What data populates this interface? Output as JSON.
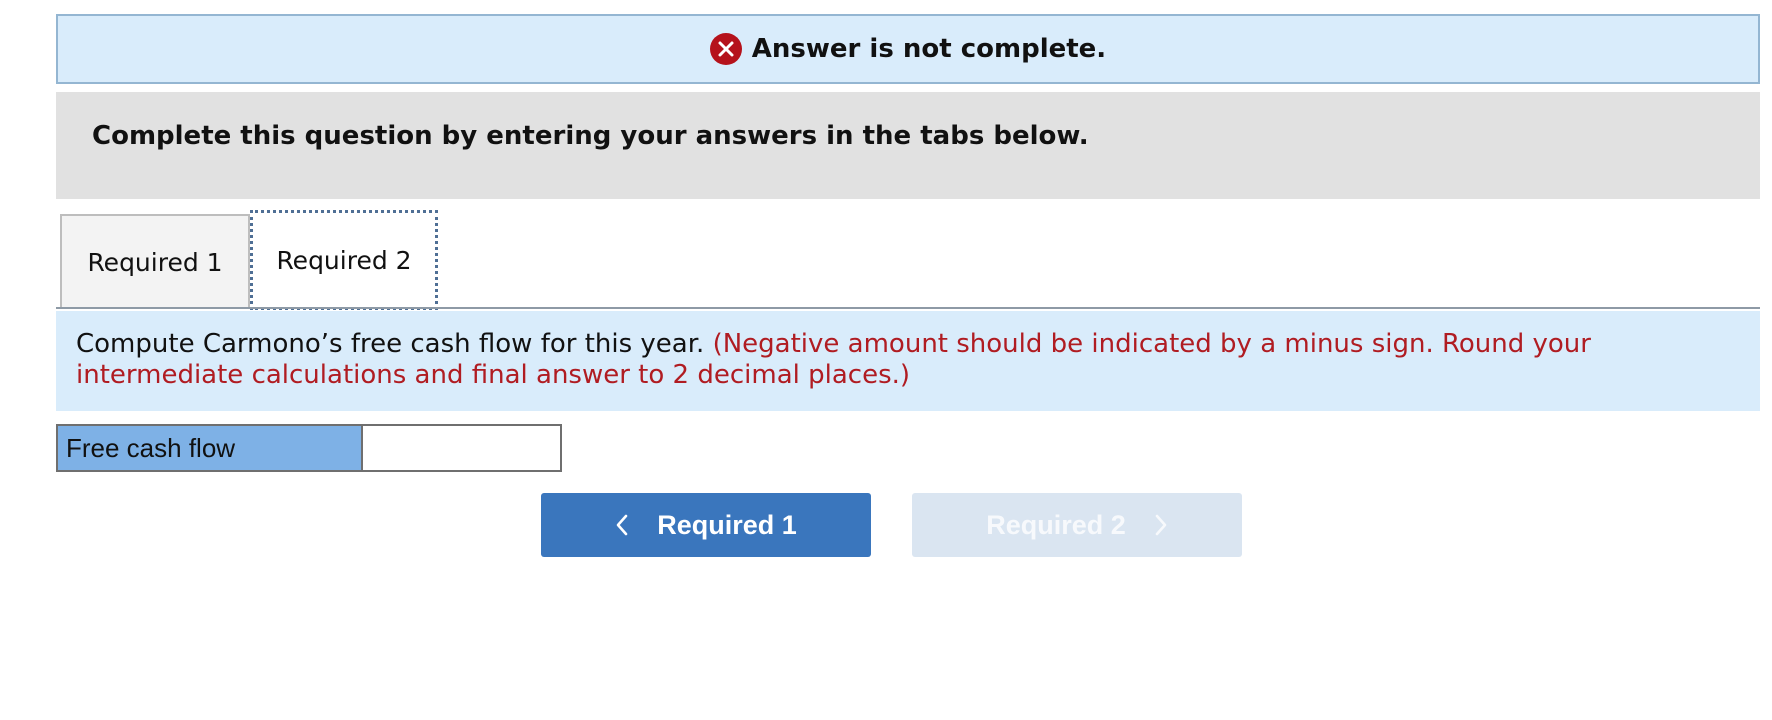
{
  "banner": {
    "text": "Answer is not complete.",
    "icon": "error-x-icon",
    "icon_color": "#b5121b",
    "background": "#d9ecfb"
  },
  "instruction": {
    "text": "Complete this question by entering your answers in the tabs below."
  },
  "tabs": [
    {
      "label": "Required 1",
      "active": false
    },
    {
      "label": "Required 2",
      "active": true
    }
  ],
  "question": {
    "text": "Compute Carmono’s free cash flow for this year.",
    "note": "(Negative amount should be indicated by a minus sign. Round your intermediate calculations and final answer to 2 decimal places.)",
    "note_color": "#b01c22"
  },
  "answer": {
    "label": "Free cash flow",
    "value": ""
  },
  "navigation": {
    "prev_label": "Required 1",
    "next_label": "Required 2",
    "prev_color": "#3a76bd",
    "next_enabled": false
  }
}
